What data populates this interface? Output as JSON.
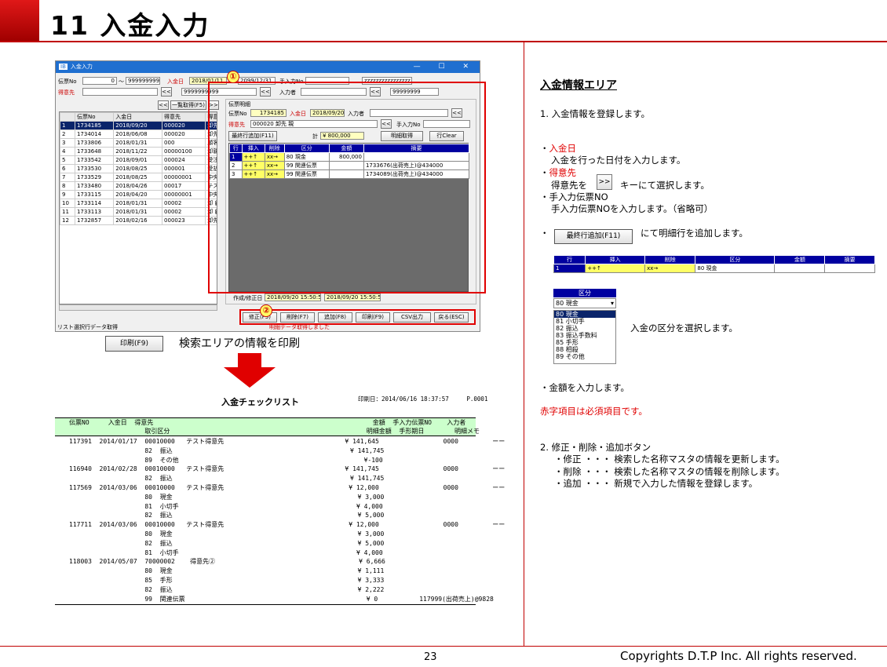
{
  "slide": {
    "title": "11  入金入力",
    "page": "23",
    "copyright": "Copyrights  D.T.P Inc. All rights reserved."
  },
  "window": {
    "title": "入金入力",
    "controls": "— ☐ ✕",
    "search": {
      "denpyo_label": "伝票No",
      "denpyo_from": "0",
      "tilde": "〜",
      "denpyo_to": "9999999999",
      "nyukin_label": "入金日",
      "nyukin_from": "2018/01/11",
      "nyukin_to": "2099/12/31",
      "tenyuryoku_label": "手入力No",
      "tenyuryoku_to": "zzzzzzzzzzzzzzzz",
      "tokui_label": "得意先",
      "tokui_to": "9999999999",
      "nyuryokusha_label": "入力者",
      "nyuryokusha_to": "99999999",
      "prev": "<<",
      "next": ">>",
      "list_btn": "一覧取得(F5)"
    },
    "list": {
      "headers": [
        "",
        "伝票No",
        "入金日",
        "得意先",
        "得意"
      ],
      "rows": [
        [
          "1",
          "1734185",
          "2018/09/20",
          "000020",
          "卸先 親"
        ],
        [
          "2",
          "1734014",
          "2018/06/08",
          "000020",
          "卸先 親"
        ],
        [
          "3",
          "1733806",
          "2018/01/31",
          "000",
          "顧客三越1111"
        ],
        [
          "4",
          "1733648",
          "2018/11/22",
          "00000100",
          "卸親"
        ],
        [
          "5",
          "1733542",
          "2018/09/01",
          "000024",
          "受注発注連携用"
        ],
        [
          "6",
          "1733530",
          "2018/08/25",
          "000001",
          "受払テスト"
        ],
        [
          "7",
          "1733529",
          "2018/08/25",
          "00000001",
          "中央株式会社"
        ],
        [
          "8",
          "1733480",
          "2018/04/26",
          "00017",
          "テスト売仕店"
        ],
        [
          "9",
          "1733115",
          "2018/04/20",
          "00000001",
          "中央株式会社"
        ],
        [
          "10",
          "1733114",
          "2018/01/31",
          "00002",
          "卸 顧客三越"
        ],
        [
          "11",
          "1733113",
          "2018/01/31",
          "00002",
          "卸 顧客三越"
        ],
        [
          "12",
          "1732857",
          "2018/02/16",
          "000023",
          "卸先"
        ]
      ]
    },
    "detail": {
      "group": "伝票明細",
      "denpyo_label": "伝票No",
      "denpyo": "1734185",
      "nyukin_label": "入金日",
      "nyukin": "2018/09/20",
      "nyuryokusha_label": "入力者",
      "tokui_label": "得意先",
      "tokui": "000020 卸先  親",
      "tenyuryoku_label": "手入力No",
      "add_btn": "最終行追加(F11)",
      "total_label": "計",
      "total": "¥ 800,000",
      "meisai_btn": "明細取得",
      "clear_btn": "行Clear",
      "headers": [
        "行",
        "挿入",
        "削除",
        "区分",
        "金額",
        "摘要"
      ],
      "rows": [
        [
          "1",
          "++↑",
          "xx→",
          "80 現金",
          "800,000",
          ""
        ],
        [
          "2",
          "++↑",
          "xx→",
          "99 関連伝票",
          "",
          "1733676(出荷売上)@434000"
        ],
        [
          "3",
          "++↑",
          "xx→",
          "99 関連伝票",
          "",
          "1734089(出荷売上)@434000"
        ]
      ],
      "date_label": "作成/修正日",
      "created": "2018/09/20 15:50:59",
      "modified": "2018/09/20 15:50:59"
    },
    "buttons": [
      "修正(F5)",
      "削除(F7)",
      "追加(F8)",
      "印刷(F9)",
      "CSV出力",
      "戻る(ESC)"
    ],
    "status_left": "リスト選択行データ取得",
    "status_right": "明細データ取得しました"
  },
  "callouts": {
    "one": "①",
    "two": "②"
  },
  "print": {
    "button": "印刷(F9)",
    "desc": "検索エリアの情報を印刷"
  },
  "report": {
    "title": "入金チェックリスト",
    "printdate": "印刷日：2014/06/16 18:37:57     P.0001",
    "header1": "伝票NO     入金日  得意先                                                          金額  手入力伝票NO    入力者",
    "header2": "                    取引区分                                                    明細金額  手形期日        明細メモ",
    "lines": [
      "117391  2014/01/17  00010000   テスト得意先                                ¥ 141,645                 0000         ーー",
      "                    82  振込                                               ¥ 141,745",
      "                    89  その他                                                 ¥-100",
      "116940  2014/02/28  00010000   テスト得意先                                ¥ 141,745                 0000         ーー",
      "                    82  振込                                               ¥ 141,745",
      "117569  2014/03/06  00010000   テスト得意先                                 ¥ 12,000                 0000         ーー",
      "                    80  現金                                                 ¥ 3,000",
      "                    81  小切手                                               ¥ 4,000",
      "                    82  振込                                                 ¥ 5,000",
      "117711  2014/03/06  00010000   テスト得意先                                 ¥ 12,000                 0000         ーー",
      "                    80  現金                                                 ¥ 3,000",
      "                    82  振込                                                 ¥ 5,000",
      "                    81  小切手                                               ¥ 4,000",
      "118003  2014/05/07  70000002    得意先②                                      ¥ 6,666",
      "                    80  現金                                                 ¥ 1,111",
      "                    85  手形                                                 ¥ 3,333",
      "                    82  振込                                                 ¥ 2,222",
      "                    99  関連伝票                                                ¥ 0           117999(出荷売上)@9828"
    ]
  },
  "right": {
    "heading": "入金情報エリア",
    "step1": "1. 入金情報を登録します。",
    "b1": "・",
    "b1_red": "入金日",
    "b1_desc": "入金を行った日付を入力します。",
    "b2": "・",
    "b2_red": "得意先",
    "b2_desc_a": "得意先を",
    "b2_btn": ">>",
    "b2_desc_b": "キーにて選択します。",
    "b3": "・手入力伝票NO",
    "b3_desc": "手入力伝票NOを入力します。（省略可）",
    "b4": "・",
    "b4_btn": "最終行追加(F11)",
    "b4_desc": "にて明細行を追加します。",
    "mini_headers": [
      "行",
      "挿入",
      "削除",
      "区分",
      "金額",
      "摘要"
    ],
    "mini_row": [
      "1",
      "++↑",
      "xx→",
      "80 現金",
      "",
      ""
    ],
    "kubun_label": "区分",
    "kubun_selected": "80 現金",
    "kubun_options": [
      "80 現金",
      "81 小切手",
      "82 振込",
      "83 振込手数料",
      "85 手形",
      "88 相殺",
      "89 その他"
    ],
    "kubun_desc": "入金の区分を選択します。",
    "b5": "・金額を入力します。",
    "required": "赤字項目は必須項目です。",
    "step2": "2. 修正・削除・追加ボタン",
    "s1": "・修正  ・・・  検索した名称マスタの情報を更新します。",
    "s2": "・削除  ・・・  検索した名称マスタの情報を削除します。",
    "s3": "・追加  ・・・  新規で入力した情報を登録します。"
  },
  "colors": {
    "accent": "#c00000",
    "header_green": "#ccffcc",
    "table_blue": "#0000a0"
  }
}
